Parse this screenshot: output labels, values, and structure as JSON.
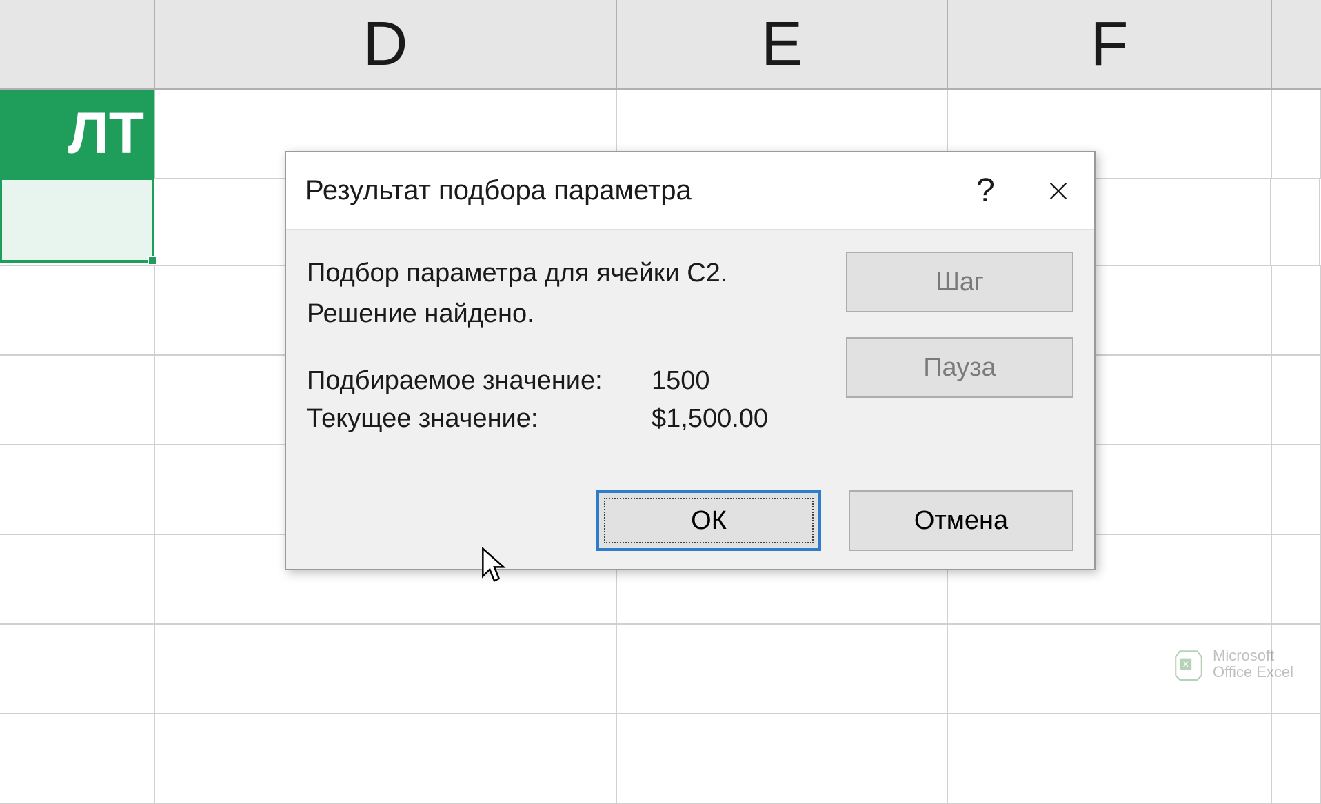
{
  "columns": {
    "d": "D",
    "e": "E",
    "f": "F"
  },
  "cell_c1_partial": "ЛТ",
  "dialog": {
    "title": "Результат подбора параметра",
    "status_line1": "Подбор параметра для ячейки C2.",
    "status_line2": "Решение найдено.",
    "target_label": "Подбираемое значение:",
    "target_value": "1500",
    "current_label": "Текущее значение:",
    "current_value": "$1,500.00",
    "step_label": "Шаг",
    "pause_label": "Пауза",
    "ok_label": "ОК",
    "cancel_label": "Отмена"
  },
  "watermark": {
    "line1": "Microsoft",
    "line2": "Office Excel"
  }
}
